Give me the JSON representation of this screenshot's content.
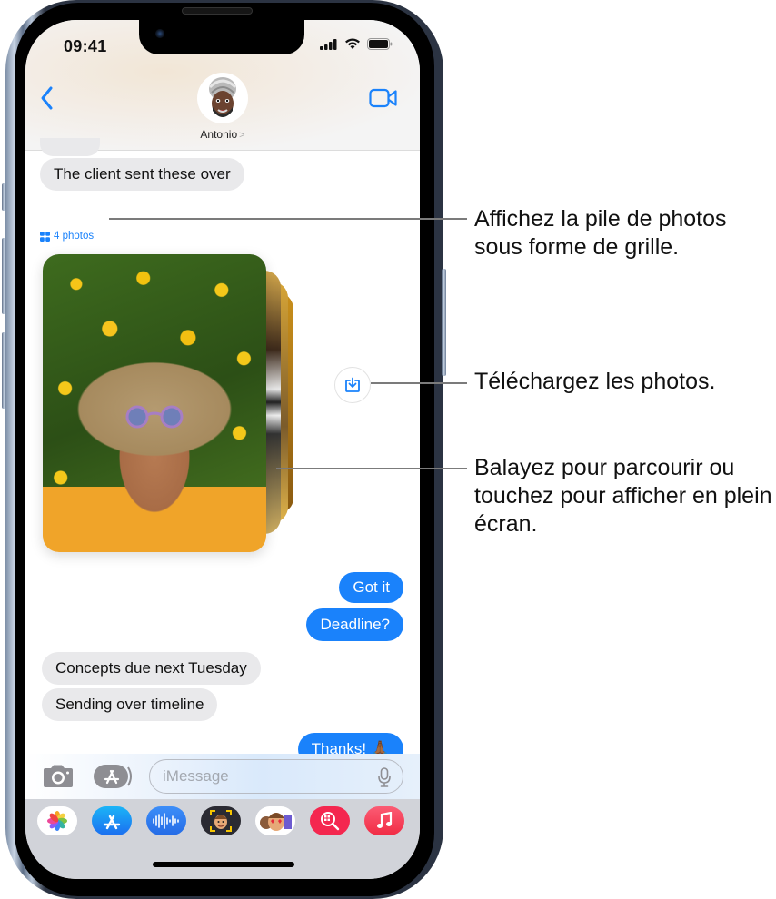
{
  "status_bar": {
    "time": "09:41",
    "icons": [
      "cellular-signal-icon",
      "wifi-icon",
      "battery-icon"
    ]
  },
  "header": {
    "back_icon": "chevron-left-icon",
    "contact_name": "Antonio",
    "contact_chevron": ">",
    "video_icon": "video-camera-icon"
  },
  "messages": [
    {
      "direction": "incoming",
      "text": "The client sent these over"
    },
    {
      "direction": "incoming",
      "type": "photo-stack",
      "label": "4 photos",
      "count": 4
    },
    {
      "direction": "outgoing",
      "text": "Got it"
    },
    {
      "direction": "outgoing",
      "text": "Deadline?"
    },
    {
      "direction": "incoming",
      "text": "Concepts due next Tuesday"
    },
    {
      "direction": "incoming",
      "text": "Sending over timeline"
    },
    {
      "direction": "outgoing",
      "text": "Thanks! 🙏🏾"
    }
  ],
  "photo_stack": {
    "grid_link_label": "4 photos",
    "grid_icon": "grid-icon",
    "download_icon": "download-icon"
  },
  "input_bar": {
    "camera_icon": "camera-icon",
    "apps_icon": "app-store-icon",
    "placeholder": "iMessage",
    "mic_icon": "microphone-icon"
  },
  "app_drawer": [
    {
      "name": "Photos",
      "icon": "photos-icon",
      "color": "#ffffff"
    },
    {
      "name": "App Store",
      "icon": "app-store-icon",
      "color": "#1e8cf5"
    },
    {
      "name": "Audio",
      "icon": "audio-waveform-icon",
      "color": "#2f7ef0"
    },
    {
      "name": "Memoji Camera",
      "icon": "memoji-camera-icon",
      "color": "#2a2a2a"
    },
    {
      "name": "Memoji Stickers",
      "icon": "memoji-stickers-icon",
      "color": "#ffffff"
    },
    {
      "name": "Images Search",
      "icon": "image-search-icon",
      "color": "#f4274f"
    },
    {
      "name": "Music",
      "icon": "music-icon",
      "color": "#f5394e"
    }
  ],
  "callouts": [
    {
      "text": "Affichez la pile de photos sous forme de grille."
    },
    {
      "text": "Téléchargez les photos."
    },
    {
      "text": "Balayez pour parcourir ou touchez pour afficher en plein écran."
    }
  ],
  "colors": {
    "accent": "#1a82fb",
    "incoming_bubble": "#e9e9eb",
    "drawer": "#d1d3d9"
  }
}
